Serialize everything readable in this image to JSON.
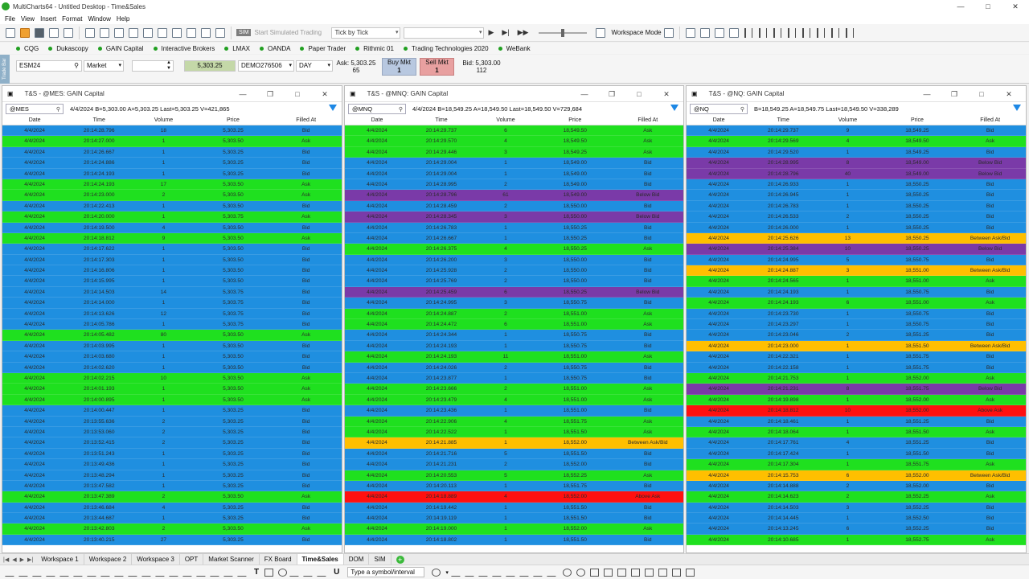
{
  "window": {
    "title": "MultiCharts64 - Untitled Desktop - Time&Sales"
  },
  "menu": [
    "File",
    "View",
    "Insert",
    "Format",
    "Window",
    "Help"
  ],
  "toolbar": {
    "sim_badge": "SIM",
    "sim_label": "Start Simulated Trading",
    "tick_mode": "Tick by Tick",
    "workspace_mode": "Workspace Mode"
  },
  "brokers": [
    "CQG",
    "Dukascopy",
    "GAIN Capital",
    "Interactive Brokers",
    "LMAX",
    "OANDA",
    "Paper Trader",
    "Rithmic 01",
    "Trading Technologies 2020",
    "WeBank"
  ],
  "tradebar": {
    "side_label": "Trade Bar",
    "symbol": "ESM24",
    "order_type": "Market",
    "price": "5,303.25",
    "account": "DEMO276506",
    "tif": "DAY",
    "ask_label": "Ask: 5,303.25",
    "ask_size": "65",
    "buy_label": "Buy Mkt",
    "buy_qty": "1",
    "sell_label": "Sell Mkt",
    "sell_qty": "1",
    "bid_label": "Bid: 5,303.00",
    "bid_size": "112"
  },
  "columns": [
    "Date",
    "Time",
    "Volume",
    "Price",
    "Filled At"
  ],
  "panels": [
    {
      "title": "T&S - @MES: GAIN Capital",
      "symbol": "@MES",
      "quote": "4/4/2024 B=5,303.00 A=5,303.25 Last=5,303.25 V=421,865",
      "rows": [
        [
          "4/4/2024",
          "20:14:28.796",
          "18",
          "5,303.25",
          "Bid",
          "bid"
        ],
        [
          "4/4/2024",
          "20:14:27.000",
          "1",
          "5,303.50",
          "Ask",
          "ask"
        ],
        [
          "4/4/2024",
          "20:14:26.667",
          "1",
          "5,303.25",
          "Bid",
          "bid"
        ],
        [
          "4/4/2024",
          "20:14:24.886",
          "1",
          "5,303.25",
          "Bid",
          "bid"
        ],
        [
          "4/4/2024",
          "20:14:24.193",
          "1",
          "5,303.25",
          "Bid",
          "bid"
        ],
        [
          "4/4/2024",
          "20:14:24.193",
          "17",
          "5,303.50",
          "Ask",
          "ask"
        ],
        [
          "4/4/2024",
          "20:14:23.000",
          "2",
          "5,303.50",
          "Ask",
          "ask"
        ],
        [
          "4/4/2024",
          "20:14:22.413",
          "1",
          "5,303.50",
          "Bid",
          "bid"
        ],
        [
          "4/4/2024",
          "20:14:20.000",
          "1",
          "5,303.75",
          "Ask",
          "ask"
        ],
        [
          "4/4/2024",
          "20:14:19.500",
          "4",
          "5,303.50",
          "Bid",
          "bid"
        ],
        [
          "4/4/2024",
          "20:14:18.812",
          "9",
          "5,303.50",
          "Ask",
          "ask"
        ],
        [
          "4/4/2024",
          "20:14:17.622",
          "1",
          "5,303.50",
          "Bid",
          "bid"
        ],
        [
          "4/4/2024",
          "20:14:17.303",
          "1",
          "5,303.50",
          "Bid",
          "bid"
        ],
        [
          "4/4/2024",
          "20:14:16.806",
          "1",
          "5,303.50",
          "Bid",
          "bid"
        ],
        [
          "4/4/2024",
          "20:14:15.995",
          "1",
          "5,303.50",
          "Bid",
          "bid"
        ],
        [
          "4/4/2024",
          "20:14:14.503",
          "14",
          "5,303.75",
          "Bid",
          "bid"
        ],
        [
          "4/4/2024",
          "20:14:14.000",
          "1",
          "5,303.75",
          "Bid",
          "bid"
        ],
        [
          "4/4/2024",
          "20:14:13.626",
          "12",
          "5,303.75",
          "Bid",
          "bid"
        ],
        [
          "4/4/2024",
          "20:14:05.786",
          "1",
          "5,303.75",
          "Bid",
          "bid"
        ],
        [
          "4/4/2024",
          "20:14:05.482",
          "80",
          "5,303.50",
          "Ask",
          "ask"
        ],
        [
          "4/4/2024",
          "20:14:03.995",
          "1",
          "5,303.50",
          "Bid",
          "bid"
        ],
        [
          "4/4/2024",
          "20:14:03.680",
          "1",
          "5,303.50",
          "Bid",
          "bid"
        ],
        [
          "4/4/2024",
          "20:14:02.620",
          "1",
          "5,303.50",
          "Bid",
          "bid"
        ],
        [
          "4/4/2024",
          "20:14:02.215",
          "10",
          "5,303.50",
          "Ask",
          "ask"
        ],
        [
          "4/4/2024",
          "20:14:01.193",
          "1",
          "5,303.50",
          "Ask",
          "ask"
        ],
        [
          "4/4/2024",
          "20:14:00.895",
          "1",
          "5,303.50",
          "Ask",
          "ask"
        ],
        [
          "4/4/2024",
          "20:14:00.447",
          "1",
          "5,303.25",
          "Bid",
          "bid"
        ],
        [
          "4/4/2024",
          "20:13:55.636",
          "2",
          "5,303.25",
          "Bid",
          "bid"
        ],
        [
          "4/4/2024",
          "20:13:53.060",
          "2",
          "5,303.25",
          "Bid",
          "bid"
        ],
        [
          "4/4/2024",
          "20:13:52.415",
          "2",
          "5,303.25",
          "Bid",
          "bid"
        ],
        [
          "4/4/2024",
          "20:13:51.243",
          "1",
          "5,303.25",
          "Bid",
          "bid"
        ],
        [
          "4/4/2024",
          "20:13:49.436",
          "1",
          "5,303.25",
          "Bid",
          "bid"
        ],
        [
          "4/4/2024",
          "20:13:48.294",
          "1",
          "5,303.25",
          "Bid",
          "bid"
        ],
        [
          "4/4/2024",
          "20:13:47.582",
          "1",
          "5,303.25",
          "Bid",
          "bid"
        ],
        [
          "4/4/2024",
          "20:13:47.389",
          "2",
          "5,303.50",
          "Ask",
          "ask"
        ],
        [
          "4/4/2024",
          "20:13:46.684",
          "4",
          "5,303.25",
          "Bid",
          "bid"
        ],
        [
          "4/4/2024",
          "20:13:44.687",
          "1",
          "5,303.25",
          "Bid",
          "bid"
        ],
        [
          "4/4/2024",
          "20:13:42.803",
          "2",
          "5,303.50",
          "Ask",
          "ask"
        ],
        [
          "4/4/2024",
          "20:13:40.215",
          "27",
          "5,303.25",
          "Bid",
          "bid"
        ]
      ]
    },
    {
      "title": "T&S - @MNQ: GAIN Capital",
      "symbol": "@MNQ",
      "quote": "4/4/2024 B=18,549.25 A=18,549.50 Last=18,549.50 V=729,684",
      "rows": [
        [
          "4/4/2024",
          "20:14:29.737",
          "6",
          "18,549.50",
          "Ask",
          "ask"
        ],
        [
          "4/4/2024",
          "20:14:29.570",
          "4",
          "18,549.50",
          "Ask",
          "ask"
        ],
        [
          "4/4/2024",
          "20:14:29.446",
          "3",
          "18,549.25",
          "Ask",
          "ask"
        ],
        [
          "4/4/2024",
          "20:14:29.004",
          "1",
          "18,549.00",
          "Bid",
          "bid"
        ],
        [
          "4/4/2024",
          "20:14:29.004",
          "1",
          "18,549.00",
          "Bid",
          "bid"
        ],
        [
          "4/4/2024",
          "20:14:28.995",
          "2",
          "18,549.00",
          "Bid",
          "bid"
        ],
        [
          "4/4/2024",
          "20:14:28.796",
          "61",
          "18,549.00",
          "Below Bid",
          "belowbid"
        ],
        [
          "4/4/2024",
          "20:14:28.459",
          "2",
          "18,550.00",
          "Bid",
          "bid"
        ],
        [
          "4/4/2024",
          "20:14:28.345",
          "3",
          "18,550.00",
          "Below Bid",
          "belowbid"
        ],
        [
          "4/4/2024",
          "20:14:26.783",
          "1",
          "18,550.25",
          "Bid",
          "bid"
        ],
        [
          "4/4/2024",
          "20:14:26.667",
          "1",
          "18,550.25",
          "Bid",
          "bid"
        ],
        [
          "4/4/2024",
          "20:14:26.375",
          "4",
          "18,550.25",
          "Ask",
          "ask"
        ],
        [
          "4/4/2024",
          "20:14:26.200",
          "3",
          "18,550.00",
          "Bid",
          "bid"
        ],
        [
          "4/4/2024",
          "20:14:25.928",
          "2",
          "18,550.00",
          "Bid",
          "bid"
        ],
        [
          "4/4/2024",
          "20:14:25.769",
          "2",
          "18,550.00",
          "Bid",
          "bid"
        ],
        [
          "4/4/2024",
          "20:14:25.459",
          "6",
          "18,550.25",
          "Below Bid",
          "belowbid"
        ],
        [
          "4/4/2024",
          "20:14:24.995",
          "3",
          "18,550.75",
          "Bid",
          "bid"
        ],
        [
          "4/4/2024",
          "20:14:24.887",
          "2",
          "18,551.00",
          "Ask",
          "ask"
        ],
        [
          "4/4/2024",
          "20:14:24.472",
          "6",
          "18,551.00",
          "Ask",
          "ask"
        ],
        [
          "4/4/2024",
          "20:14:24.344",
          "1",
          "18,550.75",
          "Bid",
          "bid"
        ],
        [
          "4/4/2024",
          "20:14:24.193",
          "1",
          "18,550.75",
          "Bid",
          "bid"
        ],
        [
          "4/4/2024",
          "20:14:24.193",
          "11",
          "18,551.00",
          "Ask",
          "ask"
        ],
        [
          "4/4/2024",
          "20:14:24.026",
          "2",
          "18,550.75",
          "Bid",
          "bid"
        ],
        [
          "4/4/2024",
          "20:14:23.877",
          "1",
          "18,550.75",
          "Bid",
          "bid"
        ],
        [
          "4/4/2024",
          "20:14:23.666",
          "2",
          "18,551.00",
          "Ask",
          "ask"
        ],
        [
          "4/4/2024",
          "20:14:23.479",
          "4",
          "18,551.00",
          "Ask",
          "ask"
        ],
        [
          "4/4/2024",
          "20:14:23.436",
          "1",
          "18,551.00",
          "Bid",
          "bid"
        ],
        [
          "4/4/2024",
          "20:14:22.906",
          "4",
          "18,551.75",
          "Ask",
          "ask"
        ],
        [
          "4/4/2024",
          "20:14:22.522",
          "1",
          "18,551.50",
          "Ask",
          "ask"
        ],
        [
          "4/4/2024",
          "20:14:21.885",
          "1",
          "18,552.00",
          "Between Ask/Bid",
          "between"
        ],
        [
          "4/4/2024",
          "20:14:21.716",
          "5",
          "18,551.50",
          "Bid",
          "bid"
        ],
        [
          "4/4/2024",
          "20:14:21.231",
          "2",
          "18,552.00",
          "Bid",
          "bid"
        ],
        [
          "4/4/2024",
          "20:14:20.553",
          "5",
          "18,552.25",
          "Ask",
          "ask"
        ],
        [
          "4/4/2024",
          "20:14:20.113",
          "1",
          "18,551.75",
          "Bid",
          "bid"
        ],
        [
          "4/4/2024",
          "20:14:18.889",
          "4",
          "18,552.00",
          "Above Ask",
          "aboveask"
        ],
        [
          "4/4/2024",
          "20:14:19.442",
          "1",
          "18,551.50",
          "Bid",
          "bid"
        ],
        [
          "4/4/2024",
          "20:14:19.119",
          "1",
          "18,551.50",
          "Bid",
          "bid"
        ],
        [
          "4/4/2024",
          "20:14:19.000",
          "1",
          "18,552.00",
          "Ask",
          "ask"
        ],
        [
          "4/4/2024",
          "20:14:18.802",
          "1",
          "18,551.50",
          "Bid",
          "bid"
        ]
      ]
    },
    {
      "title": "T&S - @NQ: GAIN Capital",
      "symbol": "@NQ",
      "quote": "B=18,549.25 A=18,549.75 Last=18,549.50 V=338,289",
      "rows": [
        [
          "4/4/2024",
          "20:14:29.737",
          "9",
          "18,549.25",
          "Bid",
          "bid"
        ],
        [
          "4/4/2024",
          "20:14:29.569",
          "4",
          "18,549.50",
          "Ask",
          "ask"
        ],
        [
          "4/4/2024",
          "20:14:29.520",
          "1",
          "18,549.25",
          "Bid",
          "bid"
        ],
        [
          "4/4/2024",
          "20:14:28.995",
          "8",
          "18,549.00",
          "Below Bid",
          "belowbid"
        ],
        [
          "4/4/2024",
          "20:14:28.796",
          "40",
          "18,549.00",
          "Below Bid",
          "belowbid"
        ],
        [
          "4/4/2024",
          "20:14:26.933",
          "1",
          "18,550.25",
          "Bid",
          "bid"
        ],
        [
          "4/4/2024",
          "20:14:26.945",
          "1",
          "18,550.25",
          "Bid",
          "bid"
        ],
        [
          "4/4/2024",
          "20:14:26.783",
          "1",
          "18,550.25",
          "Bid",
          "bid"
        ],
        [
          "4/4/2024",
          "20:14:26.533",
          "2",
          "18,550.25",
          "Bid",
          "bid"
        ],
        [
          "4/4/2024",
          "20:14:26.000",
          "1",
          "18,550.25",
          "Bid",
          "bid"
        ],
        [
          "4/4/2024",
          "20:14:25.626",
          "13",
          "18,550.25",
          "Between Ask/Bid",
          "between"
        ],
        [
          "4/4/2024",
          "20:14:25.384",
          "10",
          "18,550.25",
          "Below Bid",
          "belowbid"
        ],
        [
          "4/4/2024",
          "20:14:24.995",
          "5",
          "18,550.75",
          "Bid",
          "bid"
        ],
        [
          "4/4/2024",
          "20:14:24.887",
          "3",
          "18,551.00",
          "Between Ask/Bid",
          "between"
        ],
        [
          "4/4/2024",
          "20:14:24.565",
          "1",
          "18,551.00",
          "Ask",
          "ask"
        ],
        [
          "4/4/2024",
          "20:14:24.193",
          "1",
          "18,550.75",
          "Bid",
          "bid"
        ],
        [
          "4/4/2024",
          "20:14:24.193",
          "6",
          "18,551.00",
          "Ask",
          "ask"
        ],
        [
          "4/4/2024",
          "20:14:23.730",
          "1",
          "18,550.75",
          "Bid",
          "bid"
        ],
        [
          "4/4/2024",
          "20:14:23.297",
          "1",
          "18,550.75",
          "Bid",
          "bid"
        ],
        [
          "4/4/2024",
          "20:14:23.046",
          "2",
          "18,551.25",
          "Bid",
          "bid"
        ],
        [
          "4/4/2024",
          "20:14:23.000",
          "1",
          "18,551.50",
          "Between Ask/Bid",
          "between"
        ],
        [
          "4/4/2024",
          "20:14:22.321",
          "1",
          "18,551.75",
          "Bid",
          "bid"
        ],
        [
          "4/4/2024",
          "20:14:22.158",
          "1",
          "18,551.75",
          "Bid",
          "bid"
        ],
        [
          "4/4/2024",
          "20:14:21.753",
          "1",
          "18,552.00",
          "Ask",
          "ask"
        ],
        [
          "4/4/2024",
          "20:14:21.231",
          "8",
          "18,551.75",
          "Below Bid",
          "belowbid"
        ],
        [
          "4/4/2024",
          "20:14:19.898",
          "1",
          "18,552.00",
          "Ask",
          "ask"
        ],
        [
          "4/4/2024",
          "20:14:18.812",
          "10",
          "18,552.00",
          "Above Ask",
          "aboveask"
        ],
        [
          "4/4/2024",
          "20:14:18.461",
          "1",
          "18,551.25",
          "Bid",
          "bid"
        ],
        [
          "4/4/2024",
          "20:14:18.064",
          "1",
          "18,551.50",
          "Ask",
          "ask"
        ],
        [
          "4/4/2024",
          "20:14:17.761",
          "4",
          "18,551.25",
          "Bid",
          "bid"
        ],
        [
          "4/4/2024",
          "20:14:17.424",
          "1",
          "18,551.50",
          "Bid",
          "bid"
        ],
        [
          "4/4/2024",
          "20:14:17.304",
          "1",
          "18,551.75",
          "Ask",
          "ask"
        ],
        [
          "4/4/2024",
          "20:14:15.753",
          "6",
          "18,552.00",
          "Between Ask/Bid",
          "between"
        ],
        [
          "4/4/2024",
          "20:14:14.888",
          "2",
          "18,552.00",
          "Bid",
          "bid"
        ],
        [
          "4/4/2024",
          "20:14:14.623",
          "2",
          "18,552.25",
          "Ask",
          "ask"
        ],
        [
          "4/4/2024",
          "20:14:14.503",
          "3",
          "18,552.25",
          "Bid",
          "bid"
        ],
        [
          "4/4/2024",
          "20:14:14.445",
          "1",
          "18,552.50",
          "Bid",
          "bid"
        ],
        [
          "4/4/2024",
          "20:14:13.245",
          "6",
          "18,552.25",
          "Bid",
          "bid"
        ],
        [
          "4/4/2024",
          "20:14:10.685",
          "1",
          "18,552.75",
          "Ask",
          "ask"
        ]
      ]
    }
  ],
  "tabs": [
    "Workspace 1",
    "Workspace 2",
    "Workspace 3",
    "OPT",
    "Market Scanner",
    "FX Board",
    "Time&Sales",
    "DOM",
    "SIM"
  ],
  "active_tab": "Time&Sales",
  "drawbar": {
    "symbol_placeholder": "Type a symbol/interval"
  }
}
